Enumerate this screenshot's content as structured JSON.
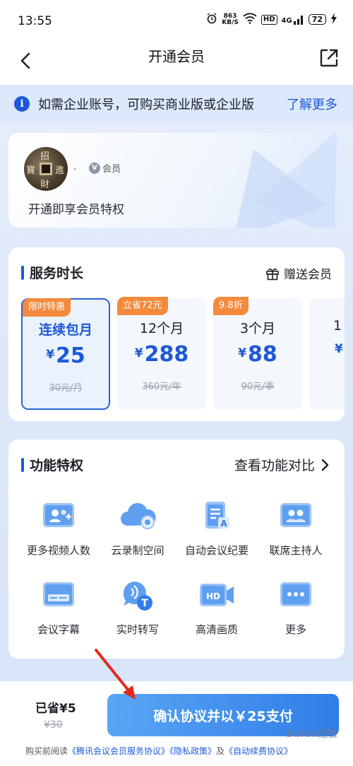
{
  "status_bar": {
    "time": "13:55",
    "speed_value": "863",
    "speed_unit": "KB/S",
    "hd": "HD",
    "signal": "4G",
    "battery": "72"
  },
  "nav": {
    "title": "开通会员"
  },
  "notice": {
    "text": "如需企业账号，可购买商业版或企业版",
    "link": "了解更多"
  },
  "user": {
    "name": ".",
    "badge": "会员",
    "badge_icon": "V",
    "subtitle": "开通即享会员特权",
    "avatar_chars": [
      "招",
      "進",
      "寶",
      "財"
    ]
  },
  "service": {
    "title": "服务时长",
    "gift_label": "赠送会员",
    "plans": [
      {
        "tag": "限时特惠",
        "name": "连续包月",
        "currency": "¥",
        "price": "25",
        "original": "30元/月",
        "selected": true
      },
      {
        "tag": "立省72元",
        "name": "12个月",
        "currency": "¥",
        "price": "288",
        "original": "360元/年",
        "selected": false
      },
      {
        "tag": "9.8折",
        "name": "3个月",
        "currency": "¥",
        "price": "88",
        "original": "90元/季",
        "selected": false
      },
      {
        "tag": "",
        "name": "1",
        "currency": "¥",
        "price": "",
        "original": "",
        "selected": false
      }
    ]
  },
  "features": {
    "title": "功能特权",
    "compare_link": "查看功能对比",
    "items": [
      {
        "label": "更多视频人数",
        "icon": "video-participants-icon"
      },
      {
        "label": "云录制空间",
        "icon": "cloud-record-icon"
      },
      {
        "label": "自动会议纪要",
        "icon": "meeting-minutes-icon"
      },
      {
        "label": "联席主持人",
        "icon": "co-host-icon"
      },
      {
        "label": "会议字幕",
        "icon": "subtitles-icon"
      },
      {
        "label": "实时转写",
        "icon": "transcribe-icon"
      },
      {
        "label": "高清画质",
        "icon": "hd-video-icon"
      },
      {
        "label": "更多",
        "icon": "more-icon"
      }
    ]
  },
  "footer": {
    "saved": "已省¥5",
    "saved_original": "¥30",
    "pay_button": "确认协议并以￥25支付",
    "agree_prefix": "购买前阅读",
    "agree_link1": "《腾讯会议会员服务协议》",
    "agree_link2": "《隐私政策》",
    "agree_and": "及",
    "agree_link3": "《自动续费协议》"
  },
  "watermark": "Baidu经验",
  "colors": {
    "accent": "#1d59d6",
    "tag_orange": "#f48a3c",
    "pay_start": "#5aa6f5",
    "pay_end": "#2f7de8"
  }
}
